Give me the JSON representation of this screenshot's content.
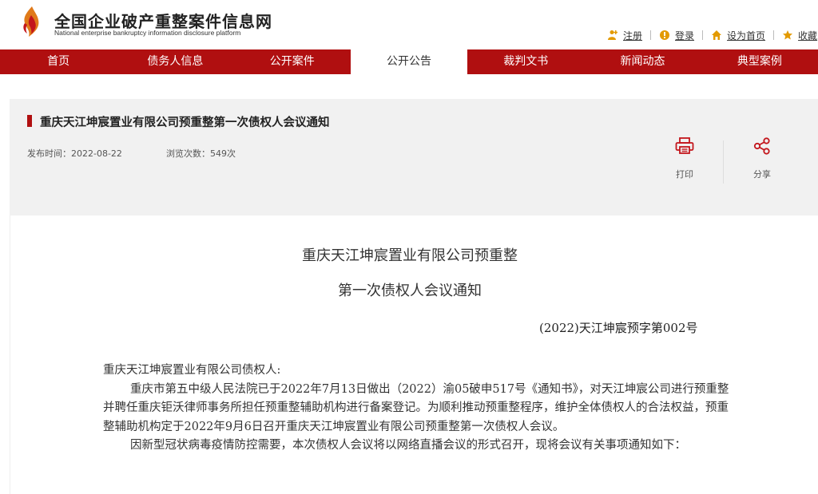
{
  "brand": {
    "title": "全国企业破产重整案件信息网",
    "subtitle": "National enterprise bankruptcy  information disclosure platform"
  },
  "toplinks": [
    {
      "label": "注册",
      "icon": "register-icon"
    },
    {
      "label": "登录",
      "icon": "login-icon"
    },
    {
      "label": "设为首页",
      "icon": "home-icon"
    },
    {
      "label": "收藏",
      "icon": "star-icon"
    }
  ],
  "nav": [
    {
      "label": "首页",
      "active": false
    },
    {
      "label": "债务人信息",
      "active": false
    },
    {
      "label": "公开案件",
      "active": false
    },
    {
      "label": "公开公告",
      "active": true
    },
    {
      "label": "裁判文书",
      "active": false
    },
    {
      "label": "新闻动态",
      "active": false
    },
    {
      "label": "典型案例",
      "active": false
    }
  ],
  "article": {
    "title": "重庆天江坤宸置业有限公司预重整第一次债权人会议通知",
    "publish_time": "发布时间：2022-08-22",
    "views": "浏览次数：549次",
    "print_label": "打印",
    "share_label": "分享"
  },
  "document": {
    "title_line1": "重庆天江坤宸置业有限公司预重整",
    "title_line2": "第一次债权人会议通知",
    "doc_number": "(2022)天江坤宸预字第002号",
    "salutation": "重庆天江坤宸置业有限公司债权人:",
    "paragraph1": "重庆市第五中级人民法院已于2022年7月13日做出（2022）渝05破申517号《通知书》，对天江坤宸公司进行预重整并聘任重庆钜沃律师事务所担任预重整辅助机构进行备案登记。为顺利推动预重整程序，维护全体债权人的合法权益，预重整辅助机构定于2022年9月6日召开重庆天江坤宸置业有限公司预重整第一次债权人会议。",
    "paragraph2": "因新型冠状病毒疫情防控需要，本次债权人会议将以网络直播会议的形式召开，现将会议有关事项通知如下："
  },
  "colors": {
    "brand_red": "#b00f10",
    "accent_orange": "#e39a00",
    "meta_bg": "#f1f1f1"
  }
}
